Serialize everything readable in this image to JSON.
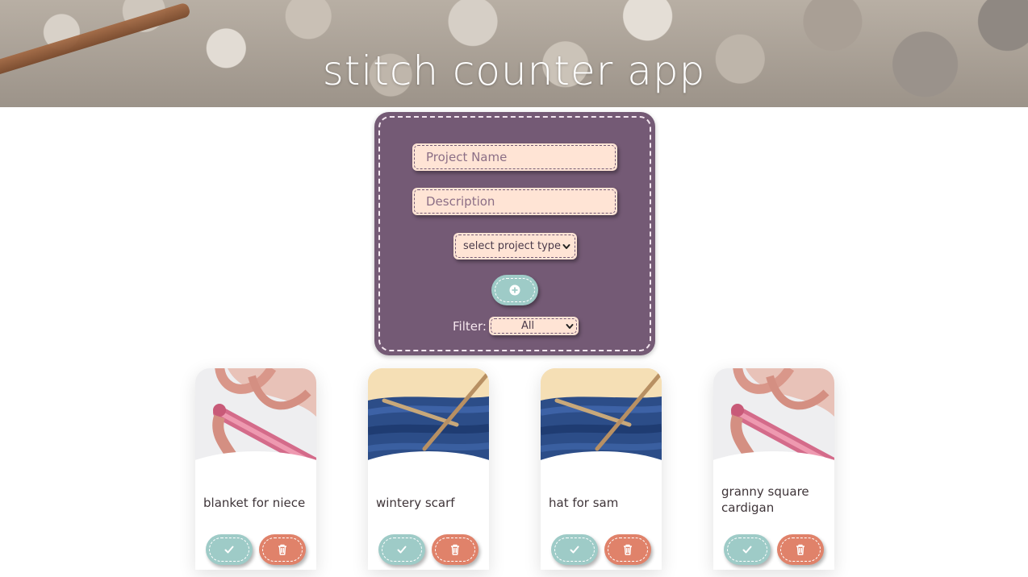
{
  "header": {
    "title": "stitch counter app"
  },
  "form": {
    "project_name_placeholder": "Project Name",
    "description_placeholder": "Description",
    "project_type_selected": "select project type",
    "filter_label": "Filter:",
    "filter_selected": "All"
  },
  "projects": [
    {
      "title": "blanket for niece",
      "image": "crochet-hook"
    },
    {
      "title": "wintery scarf",
      "image": "knitting-needles"
    },
    {
      "title": "hat for sam",
      "image": "knitting-needles"
    },
    {
      "title": "granny square cardigan",
      "image": "crochet-hook"
    }
  ],
  "colors": {
    "panel": "#745a75",
    "field": "#ffe4d5",
    "teal": "#9ecbc7",
    "coral": "#e0826a"
  }
}
